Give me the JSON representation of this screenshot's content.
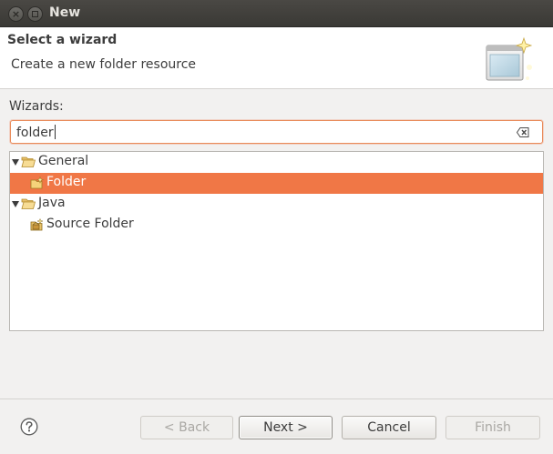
{
  "window": {
    "title": "New",
    "close_glyph": "×"
  },
  "header": {
    "title": "Select a wizard",
    "description": "Create a new folder resource",
    "banner_icon": "new-wizard-banner-icon"
  },
  "filter": {
    "label": "Wizards:",
    "value": "folder",
    "clear_icon": "clear-filter-icon"
  },
  "tree": {
    "items": [
      {
        "label": "General",
        "level": 0,
        "expanded": true,
        "icon": "folder-open-icon"
      },
      {
        "label": "Folder",
        "level": 1,
        "selected": true,
        "icon": "new-folder-icon"
      },
      {
        "label": "Java",
        "level": 0,
        "expanded": true,
        "icon": "folder-open-icon"
      },
      {
        "label": "Source Folder",
        "level": 1,
        "icon": "source-folder-icon"
      }
    ]
  },
  "buttons": {
    "help_icon": "help-icon",
    "back": "< Back",
    "next": "Next >",
    "cancel": "Cancel",
    "finish": "Finish"
  },
  "colors": {
    "selection": "#f07746",
    "focus_border": "#e98b5a",
    "titlebar": "#3c3b37"
  }
}
